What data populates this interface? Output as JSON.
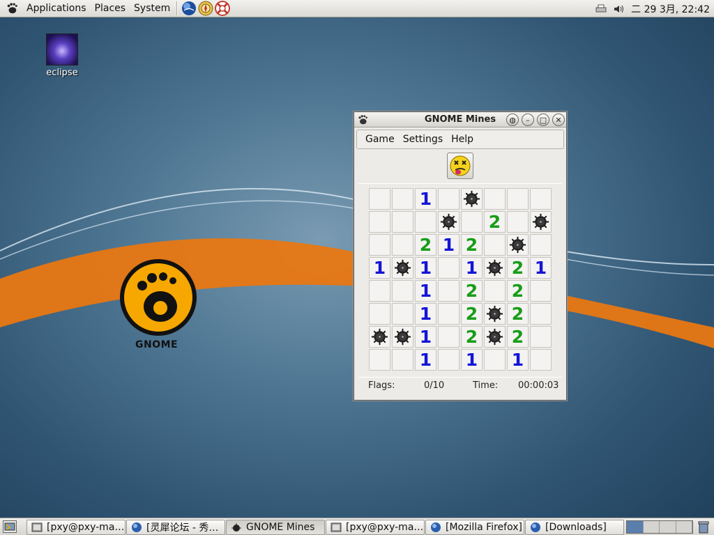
{
  "top_panel": {
    "menus": [
      "Applications",
      "Places",
      "System"
    ],
    "clock": "二 29  3月, 22:42"
  },
  "desktop": {
    "icons": [
      {
        "label": "eclipse",
        "icon": "eclipse-icon"
      }
    ],
    "wallpaper_logo_text": "GNOME"
  },
  "window": {
    "title": "GNOME Mines",
    "menu": [
      "Game",
      "Settings",
      "Help"
    ],
    "face": "dead-face-icon",
    "grid": [
      [
        "",
        "",
        "1",
        "",
        "M",
        "",
        "",
        ""
      ],
      [
        "",
        "",
        "",
        "M",
        "",
        "2",
        "",
        "M"
      ],
      [
        "",
        "",
        "2",
        "1",
        "2",
        "",
        "M",
        ""
      ],
      [
        "1",
        "M",
        "1",
        "",
        "1",
        "M",
        "2",
        "1"
      ],
      [
        "",
        "",
        "1",
        "",
        "2",
        "",
        "2",
        ""
      ],
      [
        "",
        "",
        "1",
        "",
        "2",
        "M",
        "2",
        ""
      ],
      [
        "M",
        "M",
        "1",
        "",
        "2",
        "M",
        "2",
        ""
      ],
      [
        "",
        "",
        "1",
        "",
        "1",
        "",
        "1",
        ""
      ]
    ],
    "status": {
      "flags_label": "Flags:",
      "flags_value": "0/10",
      "time_label": "Time:",
      "time_value": "00:00:03"
    }
  },
  "taskbar": {
    "tasks": [
      {
        "label": "[pxy@pxy-ma…",
        "icon": "terminal-icon"
      },
      {
        "label": "[灵犀论坛 - 秀…",
        "icon": "firefox-icon"
      },
      {
        "label": "GNOME Mines",
        "icon": "mines-icon",
        "active": true
      },
      {
        "label": "[pxy@pxy-ma…",
        "icon": "terminal-icon"
      },
      {
        "label": "[Mozilla Firefox]",
        "icon": "firefox-icon"
      },
      {
        "label": "[Downloads]",
        "icon": "firefox-icon"
      }
    ]
  },
  "colors": {
    "number_1": "#1414d6",
    "number_2": "#189d18"
  }
}
